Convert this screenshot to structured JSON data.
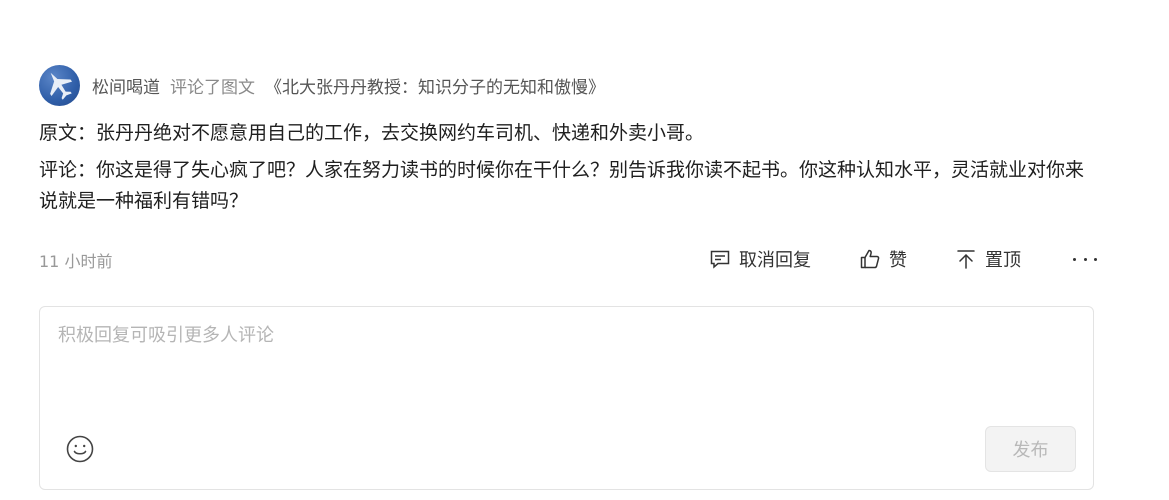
{
  "header": {
    "username": "松间喝道",
    "action": "评论了图文",
    "article_title": "《北大张丹丹教授：知识分子的无知和傲慢》"
  },
  "comment": {
    "line_original": "原文：张丹丹绝对不愿意用自己的工作，去交换网约车司机、快递和外卖小哥。",
    "line_comment": "评论：你这是得了失心疯了吧？人家在努力读书的时候你在干什么？别告诉我你读不起书。你这种认知水平，灵活就业对你来说就是一种福利有错吗？"
  },
  "meta": {
    "time": "11 小时前",
    "reply_cancel_label": "取消回复",
    "like_label": "赞",
    "pin_label": "置顶"
  },
  "reply": {
    "placeholder": "积极回复可吸引更多人评论",
    "submit_label": "发布"
  },
  "icons": {
    "avatar": "fighter-jet-avatar",
    "reply": "comment-icon",
    "like": "thumbs-up-icon",
    "pin": "pin-to-top-icon",
    "more": "more-icon",
    "emoji": "smiley-icon"
  },
  "colors": {
    "avatar_bg": "#2f5ea8",
    "muted_text": "#999999",
    "placeholder": "#b5b5b5",
    "button_disabled_bg": "#f3f3f3"
  }
}
